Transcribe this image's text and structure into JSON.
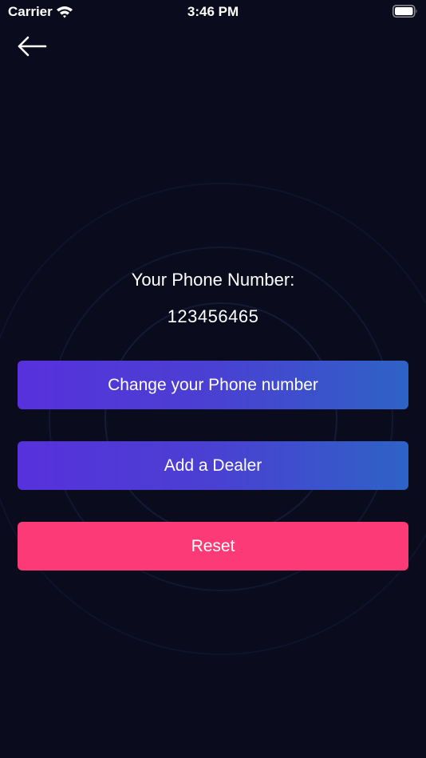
{
  "status_bar": {
    "carrier": "Carrier",
    "time": "3:46 PM",
    "wifi_icon": "wifi-icon",
    "battery_icon": "battery-icon"
  },
  "nav": {
    "back_icon": "arrow-left-icon"
  },
  "phone": {
    "label": "Your Phone Number:",
    "number": "123456465"
  },
  "actions": {
    "change_phone_label": "Change your Phone number",
    "add_dealer_label": "Add a Dealer",
    "reset_label": "Reset"
  },
  "colors": {
    "background": "#0a0b1c",
    "gradient_start": "#5731dc",
    "gradient_end": "#2e63c6",
    "reset": "#fd3a78",
    "text": "#ffffff"
  }
}
